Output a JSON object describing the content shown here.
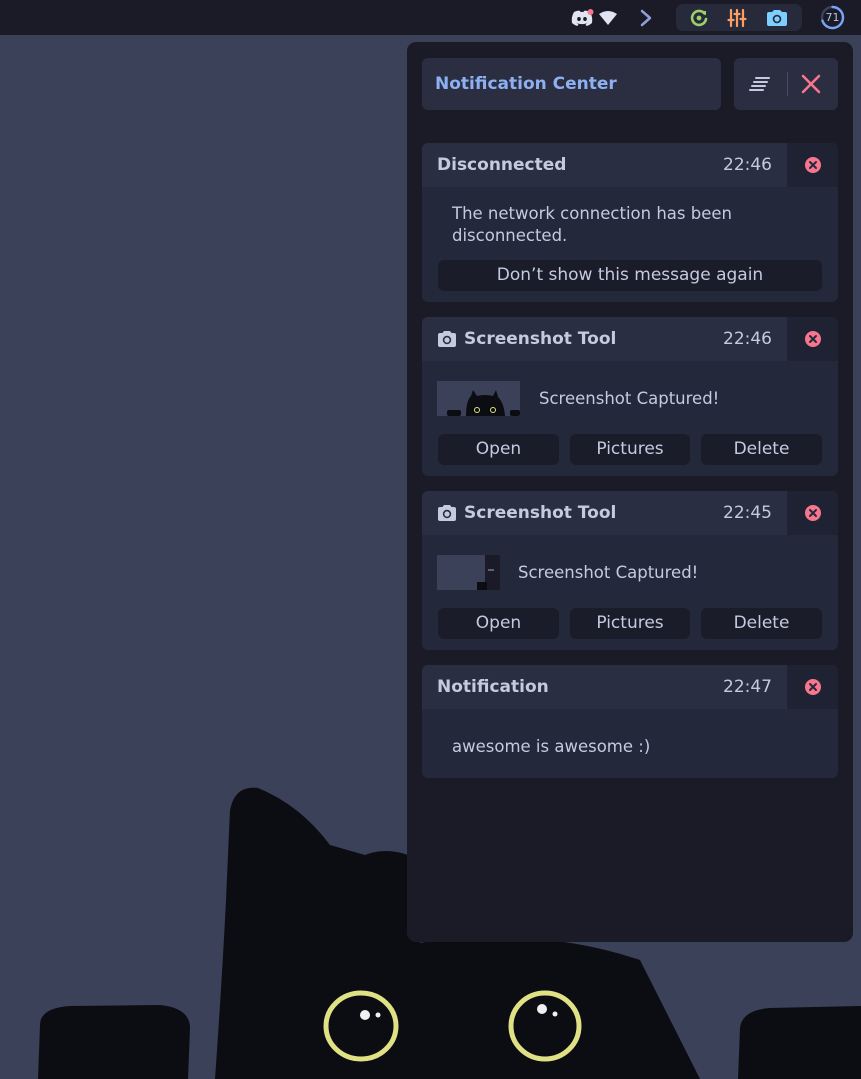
{
  "topbar": {
    "icons": [
      "discord-icon",
      "wifi-icon",
      "chevron-right-icon",
      "refresh-icon",
      "equalizer-icon",
      "camera-icon"
    ],
    "battery_level": "71",
    "colors": {
      "refresh": "#9ece6a",
      "equalizer": "#ff9e64",
      "camera": "#7dcfff",
      "discord_dot": "#f7768e"
    }
  },
  "panel": {
    "title": "Notification Center",
    "clear_icon": "clear-all-icon",
    "close_icon": "close-icon",
    "accent": "#8fb0f0",
    "close_color": "#f7768e"
  },
  "notifications": [
    {
      "title": "Disconnected",
      "time": "22:46",
      "message": "The network connection has been disconnected.",
      "actions": [
        "Don’t show this message again"
      ]
    },
    {
      "title": "Screenshot Tool",
      "icon": "camera-icon",
      "time": "22:46",
      "message": "Screenshot Captured!",
      "actions": [
        "Open",
        "Pictures",
        "Delete"
      ]
    },
    {
      "title": "Screenshot Tool",
      "icon": "camera-icon",
      "time": "22:45",
      "message": "Screenshot Captured!",
      "actions": [
        "Open",
        "Pictures",
        "Delete"
      ]
    },
    {
      "title": "Notification",
      "time": "22:47",
      "message": "awesome is awesome :)",
      "actions": []
    }
  ]
}
